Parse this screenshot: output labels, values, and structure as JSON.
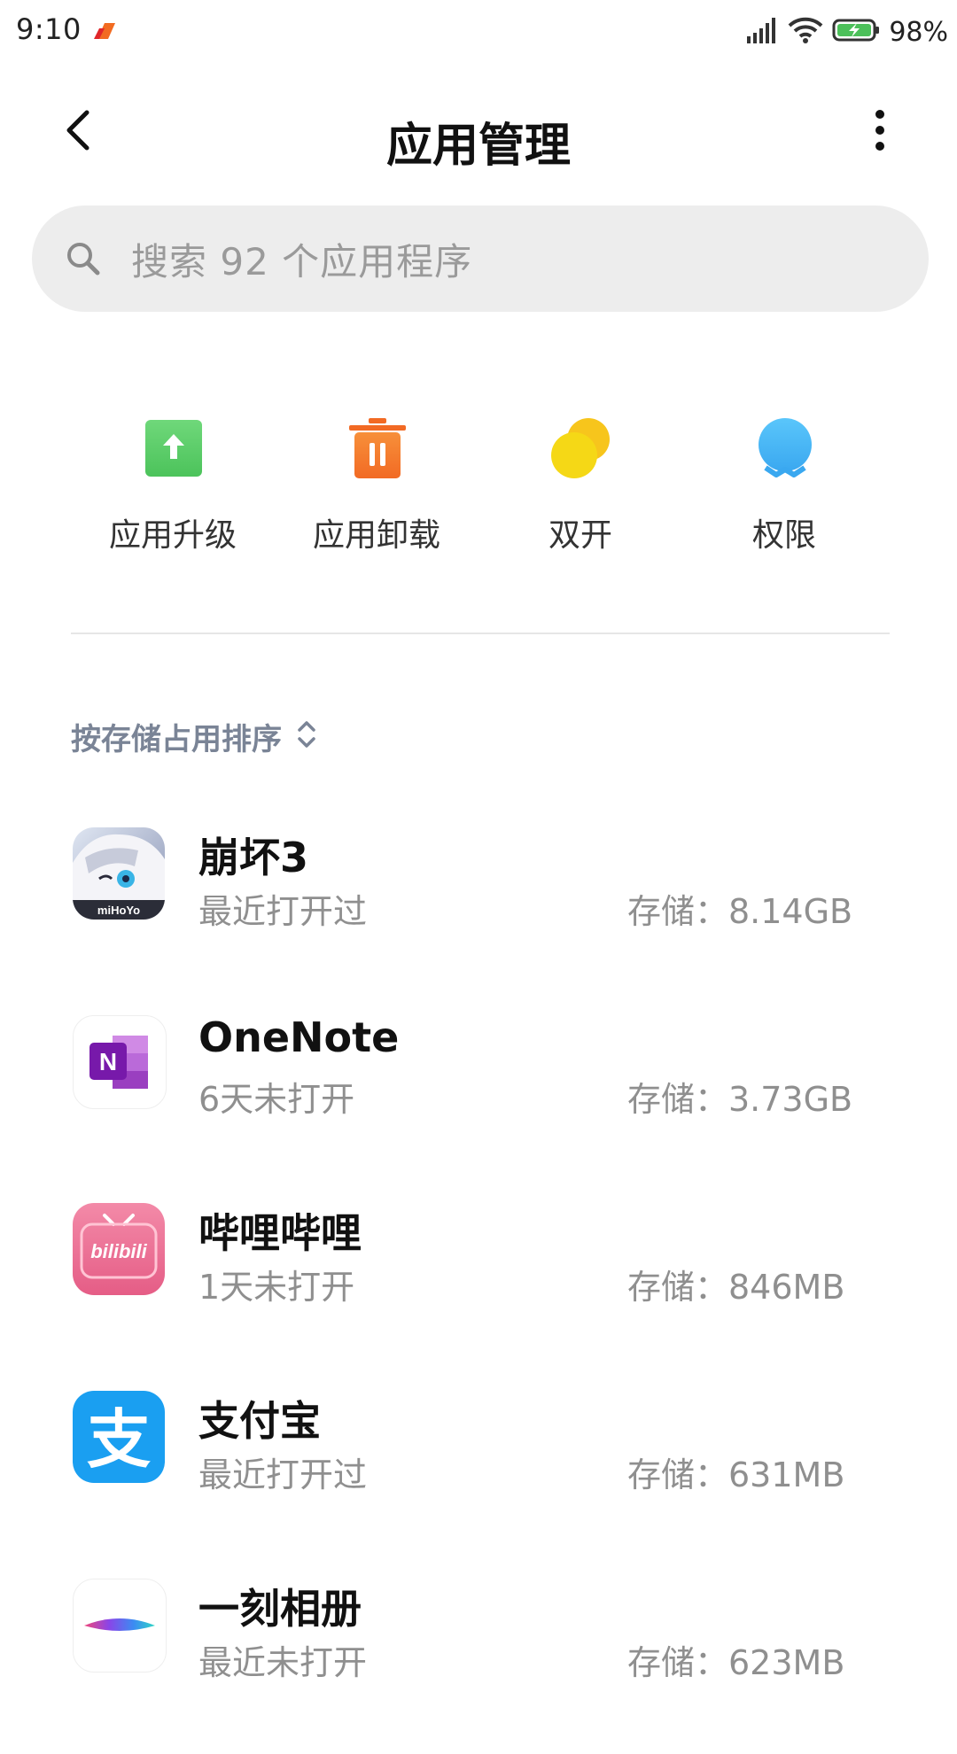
{
  "status_bar": {
    "time": "9:10",
    "battery": "98%"
  },
  "header": {
    "title": "应用管理"
  },
  "search": {
    "placeholder": "搜索 92 个应用程序"
  },
  "actions": [
    {
      "label": "应用升级",
      "icon": "upgrade-icon"
    },
    {
      "label": "应用卸载",
      "icon": "trash-icon"
    },
    {
      "label": "双开",
      "icon": "dual-app-icon"
    },
    {
      "label": "权限",
      "icon": "permission-icon"
    }
  ],
  "sort": {
    "label": "按存储占用排序"
  },
  "apps": [
    {
      "name": "崩坏3",
      "status": "最近打开过",
      "size": "存储：8.14GB",
      "icon": "honkai-icon",
      "icon_text": "miHoYo"
    },
    {
      "name": "OneNote",
      "status": "6天未打开",
      "size": "存储：3.73GB",
      "icon": "onenote-icon",
      "icon_text": "N"
    },
    {
      "name": "哔哩哔哩",
      "status": "1天未打开",
      "size": "存储：846MB",
      "icon": "bilibili-icon",
      "icon_text": "bilibili"
    },
    {
      "name": "支付宝",
      "status": "最近打开过",
      "size": "存储：631MB",
      "icon": "alipay-icon",
      "icon_text": "支"
    },
    {
      "name": "一刻相册",
      "status": "最近未打开",
      "size": "存储：623MB",
      "icon": "yike-album-icon"
    }
  ],
  "colors": {
    "upgrade": "#5fcf6d",
    "uninstall": "#f47b30",
    "dual": "#f5cf16",
    "permission": "#49b8f5",
    "sort_text": "#7a8496",
    "secondary_text": "#8f8f8f"
  }
}
